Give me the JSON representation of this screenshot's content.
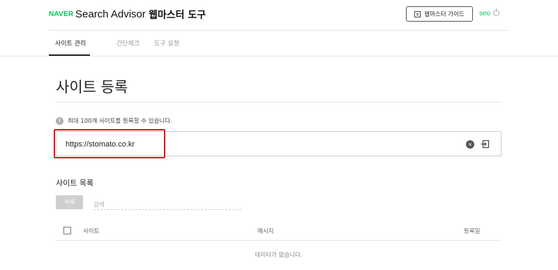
{
  "header": {
    "logo": "NAVER",
    "title": "Search Advisor",
    "subtitle": "웹마스터 도구",
    "guide_button": "웹마스터 가이드",
    "user": "seo"
  },
  "tabs": [
    {
      "label": "사이트 관리",
      "active": true
    },
    {
      "label": "간단체크",
      "active": false
    },
    {
      "label": "도구 설정",
      "active": false
    }
  ],
  "page": {
    "title": "사이트 등록",
    "info": "최대 100개 사이트를 등록할 수 있습니다.",
    "url_value": "https://stomato.co.kr"
  },
  "site_list": {
    "title": "사이트 목록",
    "delete_button": "삭제",
    "search_placeholder": "검색",
    "columns": [
      "사이트",
      "메시지",
      "등록일"
    ],
    "empty_message": "데이터가 없습니다."
  },
  "colors": {
    "brand_green": "#03c75a",
    "highlight_red": "#e0131c"
  },
  "icons": {
    "guide": "document-icon",
    "logout": "power-icon",
    "info": "info-icon",
    "clear": "clear-icon",
    "submit": "submit-icon"
  }
}
